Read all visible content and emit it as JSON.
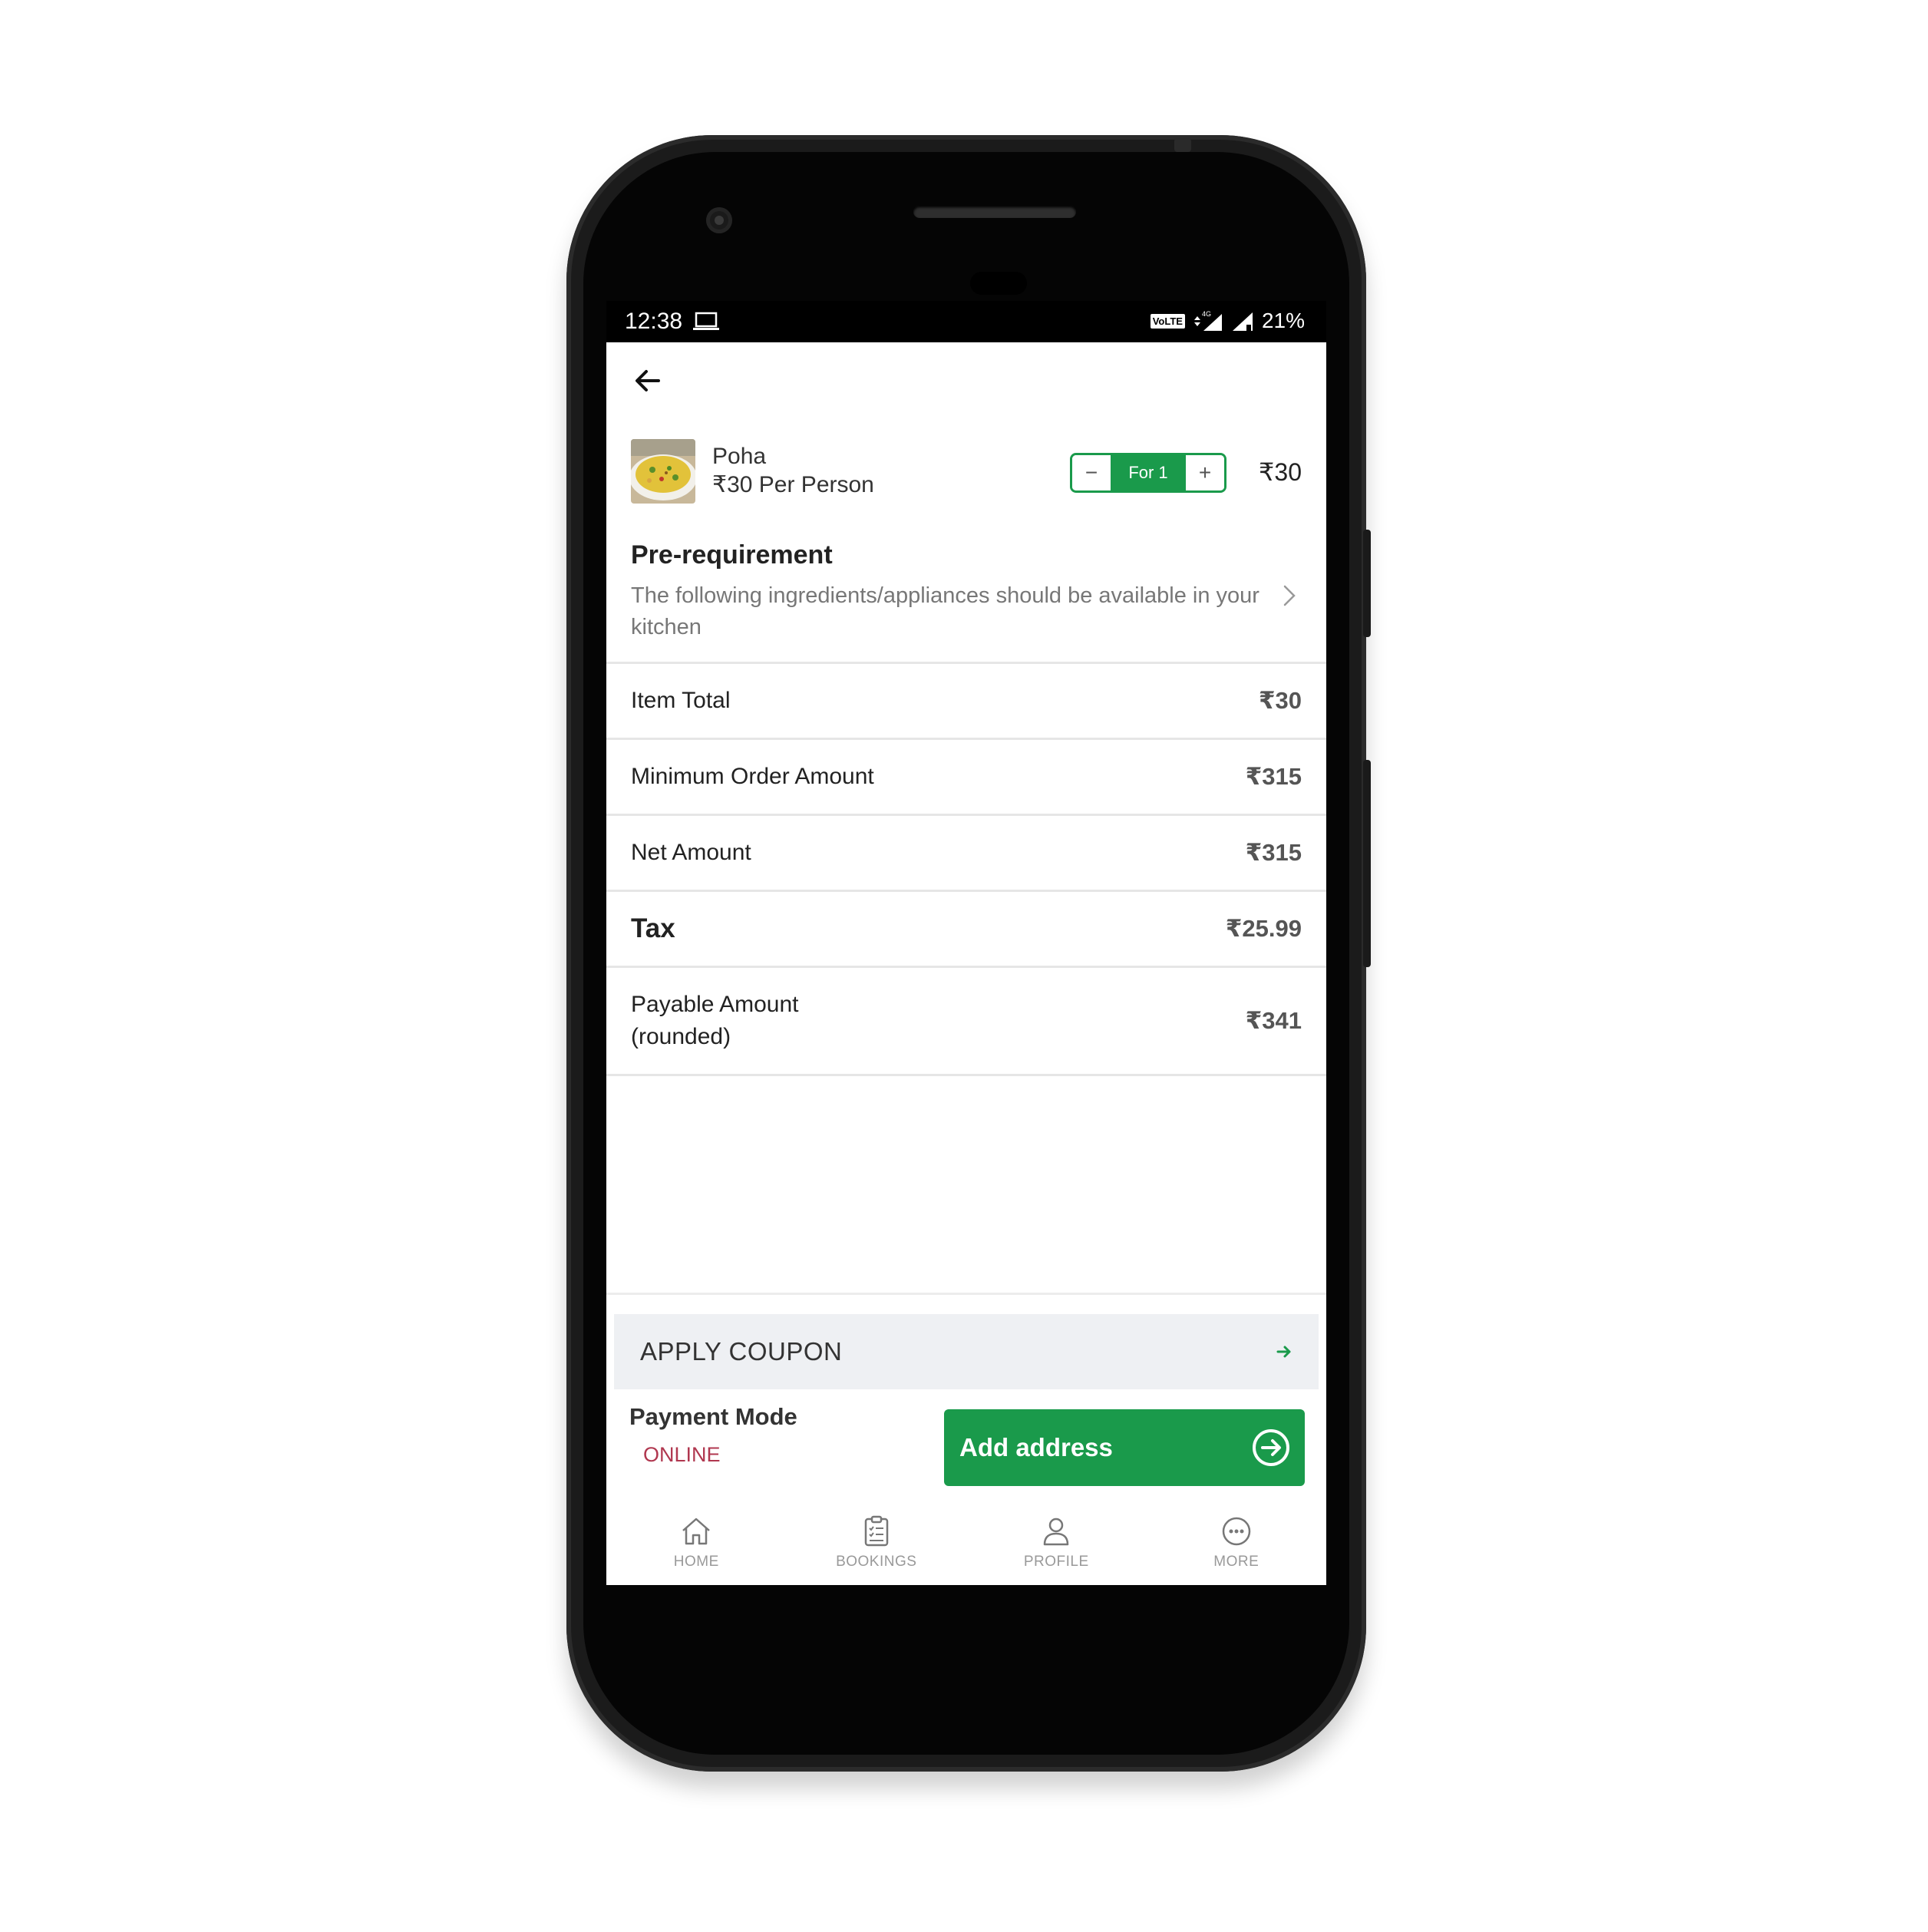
{
  "statusbar": {
    "time": "12:38",
    "volte": "VoLTE",
    "network": "4G",
    "battery": "21%"
  },
  "item": {
    "name": "Poha",
    "price_per_person": "₹30 Per Person",
    "quantity_label": "For 1",
    "minus": "−",
    "plus": "+",
    "total": "₹30"
  },
  "prerequirement": {
    "title": "Pre-requirement",
    "description": "The following ingredients/appliances should be available in your kitchen"
  },
  "bill": {
    "item_total": {
      "label": "Item Total",
      "value": "₹30"
    },
    "minimum_order": {
      "label": "Minimum Order Amount",
      "value": "₹315"
    },
    "net_amount": {
      "label": "Net Amount",
      "value": "₹315"
    },
    "tax": {
      "label": "Tax",
      "value": "₹25.99"
    },
    "payable": {
      "label": "Payable Amount (rounded)",
      "value": "₹341"
    }
  },
  "coupon": {
    "label": "APPLY COUPON"
  },
  "payment": {
    "title": "Payment Mode",
    "mode": "ONLINE",
    "button_label": "Add address"
  },
  "nav": {
    "home": "HOME",
    "bookings": "BOOKINGS",
    "profile": "PROFILE",
    "more": "MORE"
  },
  "colors": {
    "accent": "#1a9a4b",
    "payment_mode": "#b0374f",
    "coupon_bg": "#eef0f3"
  }
}
